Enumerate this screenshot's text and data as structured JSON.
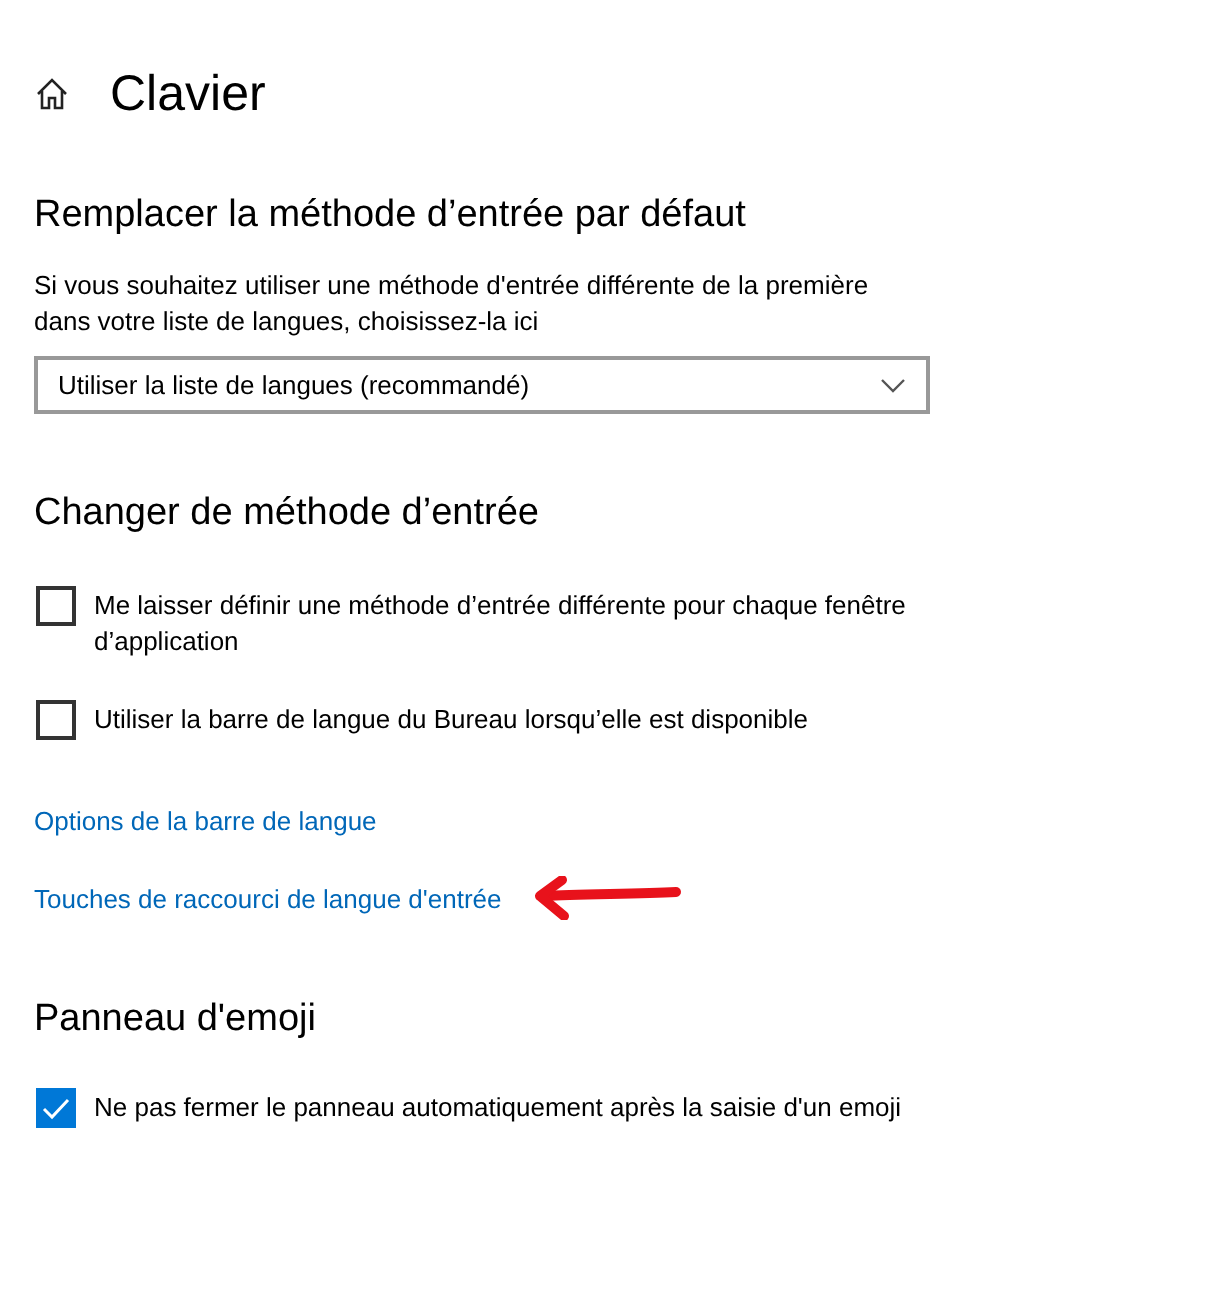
{
  "page": {
    "title": "Clavier"
  },
  "sections": [
    {
      "heading": "Remplacer la méthode d’entrée par défaut",
      "items": [
        {
          "kind": "text",
          "text": "Si vous souhaitez utiliser une méthode d'entrée différente de la première dans votre liste de langues, choisissez-la ici"
        },
        {
          "kind": "dropdown",
          "value": "Utiliser la liste de langues (recommandé)"
        }
      ]
    },
    {
      "heading": "Changer de méthode d’entrée",
      "items": [
        {
          "kind": "checkbox",
          "label": "Me laisser définir une méthode d’entrée différente pour chaque fenêtre d’application",
          "checked": false
        },
        {
          "kind": "checkbox",
          "label": "Utiliser la barre de langue du Bureau lorsqu’elle est disponible",
          "checked": false
        },
        {
          "kind": "link",
          "label": "Options de la barre de langue",
          "annotated": false
        },
        {
          "kind": "link",
          "label": "Touches de raccourci de langue d'entrée",
          "annotated": true
        }
      ]
    },
    {
      "heading": "Panneau d'emoji",
      "items": [
        {
          "kind": "checkbox",
          "label": "Ne pas fermer le panneau automatiquement après la saisie d'un emoji",
          "checked": true
        }
      ]
    }
  ]
}
